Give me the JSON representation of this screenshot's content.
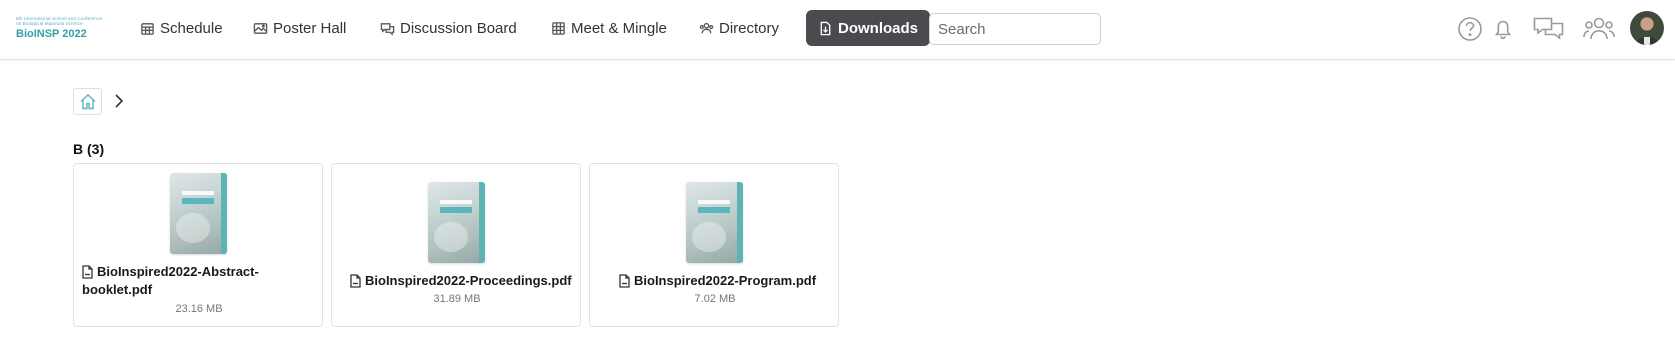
{
  "logo": {
    "small_line1": "6th International School and Conference",
    "small_line2": "on Biological Materials Science",
    "title": "BioINSP 2022"
  },
  "nav": {
    "schedule": "Schedule",
    "poster_hall": "Poster Hall",
    "discussion_board": "Discussion Board",
    "meet_mingle": "Meet & Mingle",
    "directory": "Directory",
    "downloads": "Downloads"
  },
  "search": {
    "placeholder": "Search"
  },
  "icons": {
    "help": "question-circle-icon",
    "notifications": "bell-icon",
    "chat": "chat-bubbles-icon",
    "people": "people-icon",
    "home": "home-icon",
    "separator": "chevron-right-icon",
    "file": "pdf-file-icon"
  },
  "colors": {
    "active_nav_bg": "#4a4a4f",
    "brand_teal": "#34a0a6"
  },
  "section": {
    "title": "B (3)"
  },
  "files": [
    {
      "name_line1": "BioInspired2022-Abstract-",
      "name_line2": "booklet.pdf",
      "size": "23.16 MB"
    },
    {
      "name": "BioInspired2022-Proceedings.pdf",
      "size": "31.89 MB"
    },
    {
      "name": "BioInspired2022-Program.pdf",
      "size": "7.02 MB"
    }
  ]
}
